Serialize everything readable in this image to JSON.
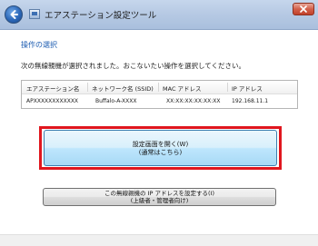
{
  "window": {
    "title": "エアステーション設定ツール",
    "icons": {
      "back": "back-arrow-icon",
      "app": "app-icon",
      "close": "close-icon"
    }
  },
  "main": {
    "section_title": "操作の選択",
    "instruction": "次の無線親機が選択されました。おこないたい操作を選択してください。",
    "table": {
      "headers": [
        "エアステーション名",
        "ネットワーク名 (SSID)",
        "MAC アドレス",
        "IP アドレス"
      ],
      "rows": [
        [
          "APXXXXXXXXXXXX",
          "Buffalo-A-XXXX",
          "XX:XX:XX:XX:XX:XX",
          "192.168.11.1"
        ]
      ]
    },
    "primary_button": {
      "line1": "設定画面を開く(W)",
      "line2": "(通常はこちら)"
    },
    "secondary_button": {
      "line1": "この無線親機の IP アドレスを設定する(I)",
      "line2": "(上級者・管理者向け)"
    }
  },
  "colors": {
    "accent": "#1b5bb0",
    "highlight": "#e0161e",
    "primary_button_border": "#3c7fb1"
  }
}
